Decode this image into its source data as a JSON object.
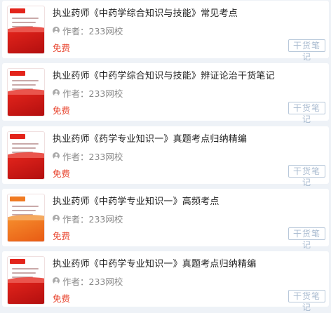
{
  "items": [
    {
      "title": "执业药师《中药学综合知识与技能》常见考点",
      "author_label": "作者：",
      "author": "233网校",
      "price": "免费",
      "badge": "干货笔记",
      "cover_theme": "red",
      "cover_icon": "book-cover"
    },
    {
      "title": "执业药师《中药学综合知识与技能》辨证论治干货笔记",
      "author_label": "作者：",
      "author": "233网校",
      "price": "免费",
      "badge": "干货笔记",
      "cover_theme": "red",
      "cover_icon": "book-cover"
    },
    {
      "title": "执业药师《药学专业知识一》真题考点归纳精编",
      "author_label": "作者：",
      "author": "233网校",
      "price": "免费",
      "badge": "干货笔记",
      "cover_theme": "red",
      "cover_icon": "book-cover"
    },
    {
      "title": "执业药师《中药学专业知识一》高频考点",
      "author_label": "作者：",
      "author": "233网校",
      "price": "免费",
      "badge": "干货笔记",
      "cover_theme": "orange",
      "cover_icon": "book-cover"
    },
    {
      "title": "执业药师《中药学专业知识一》真题考点归纳精编",
      "author_label": "作者：",
      "author": "233网校",
      "price": "免费",
      "badge": "干货笔记",
      "cover_theme": "red",
      "cover_icon": "book-cover"
    }
  ],
  "colors": {
    "background": "#eef2f7",
    "price": "#e8452f",
    "badge_border": "#b8c8da",
    "badge_text": "#a9bbd0"
  }
}
